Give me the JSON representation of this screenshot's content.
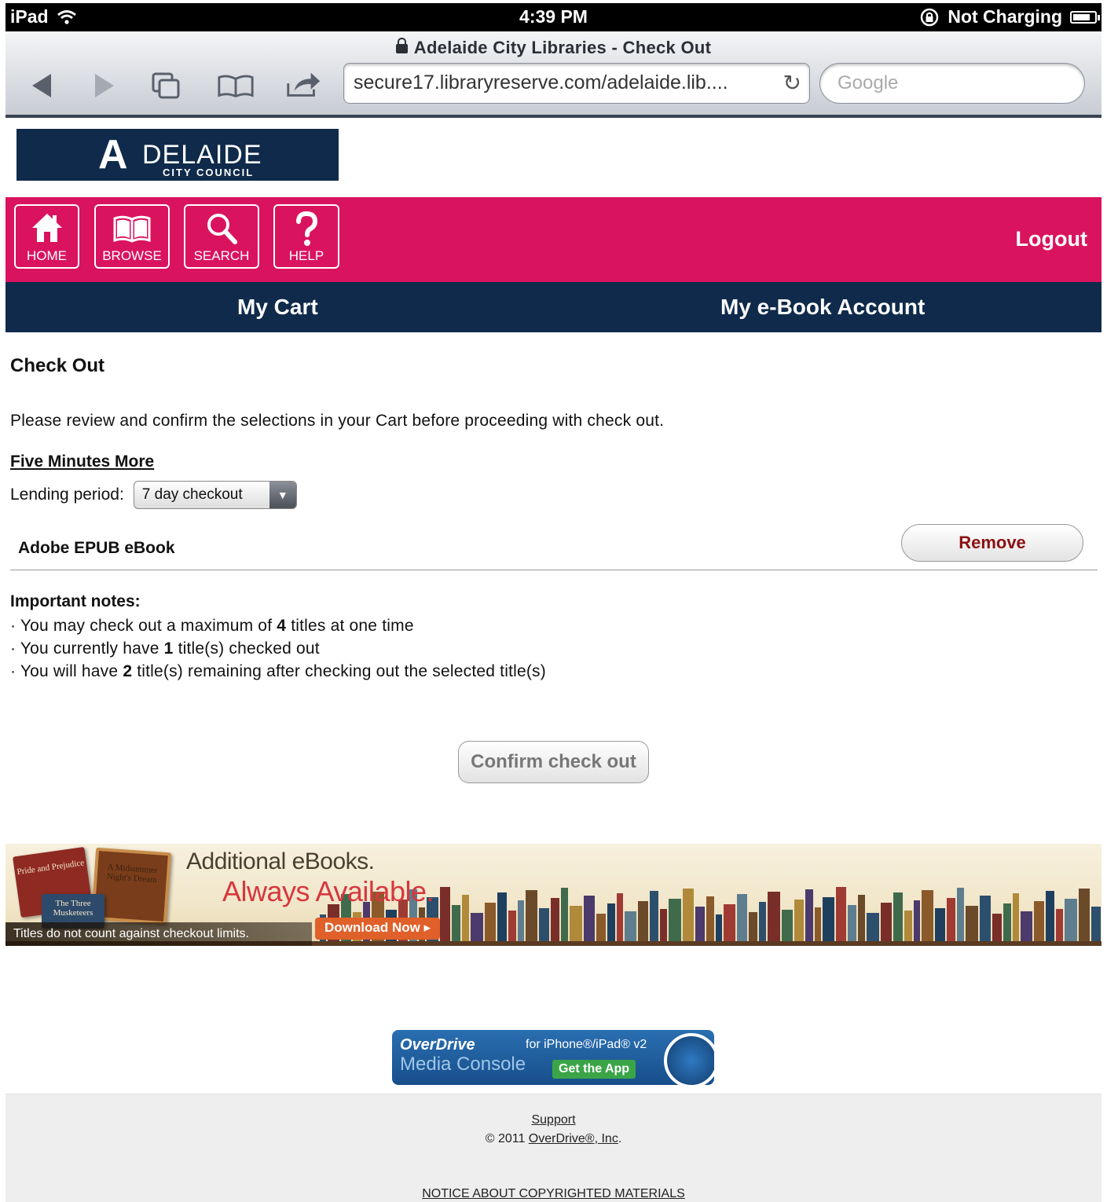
{
  "status_bar": {
    "device": "iPad",
    "time": "4:39 PM",
    "charging": "Not Charging"
  },
  "browser": {
    "page_title": "Adelaide City Libraries - Check Out",
    "url": "secure17.libraryreserve.com/adelaide.lib....",
    "search_placeholder": "Google",
    "icons": [
      "back-icon",
      "forward-icon",
      "pages-icon",
      "bookmarks-icon",
      "share-icon",
      "reload-icon",
      "lock-icon"
    ]
  },
  "site": {
    "logo_main": "DELAIDE",
    "logo_mark": "A",
    "logo_sub": "CITY COUNCIL",
    "nav": [
      {
        "label": "HOME",
        "icon": "home-icon"
      },
      {
        "label": "BROWSE",
        "icon": "book-icon"
      },
      {
        "label": "SEARCH",
        "icon": "search-icon"
      },
      {
        "label": "HELP",
        "icon": "help-icon"
      }
    ],
    "logout": "Logout",
    "tabs": [
      "My Cart",
      "My e-Book Account"
    ],
    "colors": {
      "pink": "#da135f",
      "navy": "#0f2a4a",
      "remove": "#8b0f12"
    }
  },
  "checkout": {
    "heading": "Check Out",
    "intro": "Please review and confirm the selections in your Cart before proceeding with check out.",
    "book_title": "Five Minutes More",
    "lending_label": "Lending period:",
    "lending_value": "7 day checkout",
    "format": "Adobe EPUB eBook",
    "remove": "Remove",
    "notes_heading": "Important notes:",
    "notes": [
      {
        "pre": "You may check out a maximum of ",
        "num": "4",
        "post": " titles at one time"
      },
      {
        "pre": "You currently have ",
        "num": "1",
        "post": " title(s) checked out"
      },
      {
        "pre": "You will have ",
        "num": "2",
        "post": " title(s) remaining after checking out the selected title(s)"
      }
    ],
    "confirm": "Confirm check out"
  },
  "banner": {
    "head1": "Additional eBooks.",
    "head2": "Always Available.",
    "note": "Titles do not count against checkout limits.",
    "download": "Download Now ▸",
    "book1": "Pride and Prejudice",
    "book2": "A Midsummer Night's Dream",
    "book3": "The Three Musketeers"
  },
  "overdrive": {
    "title": "OverDrive",
    "subtitle": "Media Console",
    "for": "for iPhone®/iPad® v2",
    "get": "Get the App"
  },
  "footer": {
    "support": "Support",
    "copyright_pre": "© 2011 ",
    "copyright_link": "OverDrive®, Inc",
    "copyright_post": ".",
    "notice": "NOTICE ABOUT COPYRIGHTED MATERIALS"
  }
}
